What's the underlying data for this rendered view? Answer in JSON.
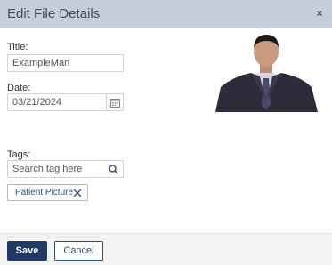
{
  "dialog": {
    "title": "Edit File Details",
    "close_glyph": "×"
  },
  "form": {
    "title_label": "Title:",
    "title_value": "ExampleMan",
    "date_label": "Date:",
    "date_value": "03/21/2024",
    "tags_label": "Tags:",
    "tag_search_placeholder": "Search tag here",
    "tags": [
      "Patient Picture"
    ]
  },
  "icons": {
    "calendar": "calendar-icon",
    "search": "search-icon",
    "remove_tag": "close-icon",
    "photo": "person-photo"
  },
  "footer": {
    "save_label": "Save",
    "cancel_label": "Cancel"
  },
  "colors": {
    "header_bg": "#c5cedb",
    "primary": "#1f3a66",
    "accent_text": "#2f4d7a"
  }
}
